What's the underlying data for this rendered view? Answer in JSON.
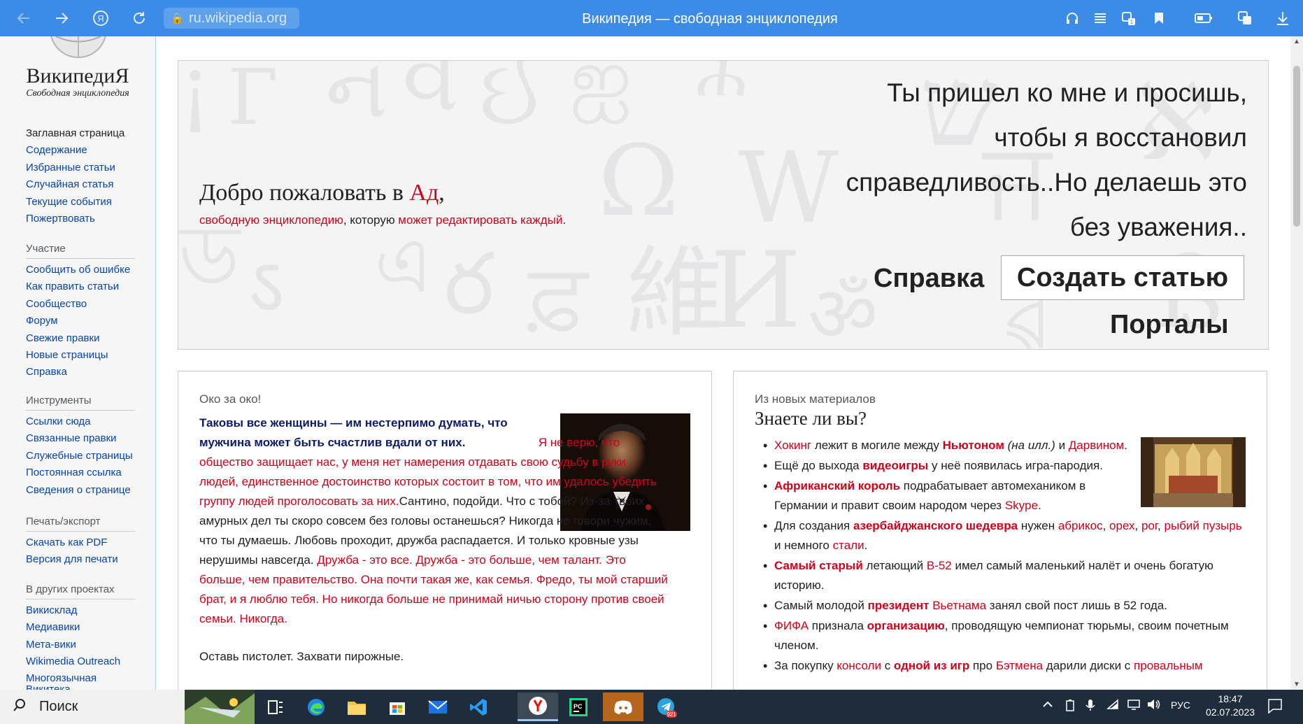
{
  "browser": {
    "url": "ru.wikipedia.org",
    "page_title": "Википедия — свободная энциклопедия",
    "nav_icons": [
      "back-arrow-icon",
      "forward-arrow-icon",
      "yandex-icon",
      "reload-icon"
    ],
    "toolbar_icons": [
      "headphones-icon",
      "reader-icon",
      "collections-icon",
      "bookmark-icon",
      "battery-icon",
      "translate-icon",
      "download-icon"
    ],
    "collections_badge": "1"
  },
  "sidebar": {
    "logo_title": "ВикипедиЯ",
    "logo_subtitle": "Свободная энциклопедия",
    "main_links": [
      "Заглавная страница",
      "Содержание",
      "Избранные статьи",
      "Случайная статья",
      "Текущие события",
      "Пожертвовать"
    ],
    "sections": [
      {
        "title": "Участие",
        "links": [
          "Сообщить об ошибке",
          "Как править статьи",
          "Сообщество",
          "Форум",
          "Свежие правки",
          "Новые страницы",
          "Справка"
        ]
      },
      {
        "title": "Инструменты",
        "links": [
          "Ссылки сюда",
          "Связанные правки",
          "Служебные страницы",
          "Постоянная ссылка",
          "Сведения о странице"
        ]
      },
      {
        "title": "Печать/экспорт",
        "links": [
          "Скачать как PDF",
          "Версия для печати"
        ]
      },
      {
        "title": "В других проектах",
        "links": [
          "Викисклад",
          "Медиавики",
          "Мета-вики",
          "Wikimedia Outreach",
          "Многоязычная Викитека"
        ]
      }
    ]
  },
  "banner": {
    "welcome_prefix": "Добро пожаловать в ",
    "welcome_link": "Ад",
    "welcome_suffix": ",",
    "sub_link1": "свободную энциклопедию",
    "sub_text": ", которую ",
    "sub_link2": "может редактировать каждый",
    "sub_end": ".",
    "quote_lines": [
      "Ты пришел ко мне и просишь,",
      "чтобы я восстановил",
      "справедливость..Но делаешь это",
      "без уважения.."
    ],
    "help_label": "Справка",
    "create_label": "Создать статью",
    "portals_label": "Порталы"
  },
  "featured": {
    "kicker": "Око за око!",
    "bold_lead": "Таковы все женщины — им нестерпимо думать, что мужчина может быть счастлив вдали от них.",
    "red1": "Я не верю, что общество защищает нас, у меня нет намерения отдавать свою судьбу в руки людей, единственное достоинство которых состоит в том, что им удалось убедить группу людей проголосовать за них.",
    "plain1": "Сантино, подойди. Что с тобой? Из-за твоих амурных дел ты скоро совсем без головы останешься? Никогда не говори чужим, что ты думаешь. Любовь проходит, дружба распадается. И только кровные узы нерушимы навсегда.",
    "red2": "Дружба - это все. Дружба - это больше, чем талант. Это больше, чем правительство. Она почти такая же, как семья. Фредо, ты мой старший брат, и я люблю тебя. Но никогда больше не принимай ничью сторону против своей семьи. Никогда.",
    "last_line": "Оставь пистолет. Захвати пирожные."
  },
  "dyk": {
    "kicker": "Из новых материалов",
    "title": "Знаете ли вы?",
    "items": [
      [
        {
          "t": "Хокинг",
          "c": "red"
        },
        {
          "t": " лежит в могиле между "
        },
        {
          "t": "Ньютоном",
          "c": "red bold"
        },
        {
          "t": " "
        },
        {
          "t": "(на илл.)",
          "c": "italic"
        },
        {
          "t": " и "
        },
        {
          "t": "Дарвином",
          "c": "red"
        },
        {
          "t": "."
        }
      ],
      [
        {
          "t": "Ещё до выхода "
        },
        {
          "t": "видеоигры",
          "c": "red bold"
        },
        {
          "t": " у неё появилась игра-пародия."
        }
      ],
      [
        {
          "t": "Африканский король",
          "c": "red bold"
        },
        {
          "t": " подрабатывает автомехаником в Германии и правит своим народом через "
        },
        {
          "t": "Skype",
          "c": "red"
        },
        {
          "t": "."
        }
      ],
      [
        {
          "t": "Для создания "
        },
        {
          "t": "азербайджанского шедевра",
          "c": "red bold"
        },
        {
          "t": " нужен "
        },
        {
          "t": "абрикос",
          "c": "red"
        },
        {
          "t": ", "
        },
        {
          "t": "орех",
          "c": "red"
        },
        {
          "t": ", "
        },
        {
          "t": "рог",
          "c": "red"
        },
        {
          "t": ", "
        },
        {
          "t": "рыбий пузырь",
          "c": "red"
        },
        {
          "t": " и немного "
        },
        {
          "t": "стали",
          "c": "red"
        },
        {
          "t": "."
        }
      ],
      [
        {
          "t": "Самый старый",
          "c": "red bold"
        },
        {
          "t": " летающий "
        },
        {
          "t": "B-52",
          "c": "red"
        },
        {
          "t": " имел самый маленький налёт и очень богатую историю."
        }
      ],
      [
        {
          "t": "Самый молодой "
        },
        {
          "t": "президент",
          "c": "red bold"
        },
        {
          "t": " "
        },
        {
          "t": "Вьетнама",
          "c": "red"
        },
        {
          "t": " занял свой пост лишь в 52 года."
        }
      ],
      [
        {
          "t": "ФИФА",
          "c": "red"
        },
        {
          "t": " признала "
        },
        {
          "t": "организацию",
          "c": "red bold"
        },
        {
          "t": ", проводящую чемпионат тюрьмы, своим почетным членом."
        }
      ],
      [
        {
          "t": "За покупку "
        },
        {
          "t": "консоли",
          "c": "red"
        },
        {
          "t": " с "
        },
        {
          "t": "одной из игр",
          "c": "red bold"
        },
        {
          "t": " про "
        },
        {
          "t": "Бэтмена",
          "c": "red"
        },
        {
          "t": " дарили диски с "
        },
        {
          "t": "провальным",
          "c": "red"
        }
      ]
    ]
  },
  "taskbar": {
    "search_label": "Поиск",
    "telegram_badge": "921",
    "language": "РУС",
    "time": "18:47",
    "date": "02.07.2023"
  }
}
